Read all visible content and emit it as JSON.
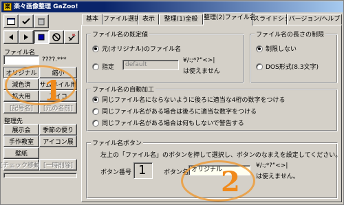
{
  "window": {
    "title": "楽々画像整理 GaZoo!",
    "icon_text": "楽"
  },
  "toolbar": {
    "icons": [
      "window-icon",
      "check-icon",
      "trash-icon",
      "back-icon",
      "forward-icon",
      "stop-icon",
      "no-entry-icon",
      "erase-icon"
    ]
  },
  "sidebar": {
    "filename_label": "ファイル名",
    "filename_value": "",
    "filename_ext": "????.***",
    "name_buttons": [
      "オリジナル",
      "縮小",
      "減色済",
      "サムネイル用",
      "拡大用",
      "アイコ"
    ],
    "disabled_buttons": [
      "[記号名]",
      "[元の名前]"
    ],
    "organize_label": "整理先",
    "folder_buttons": [
      "展示会",
      "季節の便り",
      "手作教室",
      "アイコン展",
      "壁紙"
    ],
    "action_buttons": [
      "[チェック移動]",
      "[一時削除]"
    ]
  },
  "tabs": [
    {
      "label": "基本",
      "active": false
    },
    {
      "label": "ファイル選択",
      "active": false
    },
    {
      "label": "表示",
      "active": false
    },
    {
      "label": "整理(1)全般",
      "active": false
    },
    {
      "label": "整理(2)ファイル名",
      "active": true
    },
    {
      "label": "スライドショー",
      "active": false
    },
    {
      "label": "バージョン/ヘルプ",
      "active": false
    }
  ],
  "default_group": {
    "title": "ファイル名の既定値",
    "option_original": "元(オリジナル)のファイル名",
    "option_custom": "指定",
    "custom_value": "default",
    "invalid_chars": "¥/:;*?\"<>|",
    "invalid_note": "は使えません"
  },
  "length_group": {
    "title": "ファイル名の長さの制限",
    "option_unlimited": "制限しない",
    "option_dos": "DOS形式(8.3文字)"
  },
  "auto_group": {
    "title": "ファイル名の自動加工",
    "options": [
      "同じファイル名にならないように後ろに適当な4桁の数字をつける",
      "同じファイル名がある場合は後ろに適当な数字をつける",
      "同じファイル名がある場合は何もしないで警告する"
    ]
  },
  "button_group": {
    "title": "ファイル名ボタン",
    "instruction": "左上の「ファイル名」のボタンを押して選択し、ボタンのなまえを設定してください。",
    "number_label": "ボタン番号",
    "number_value": "1",
    "name_label": "ボタン名",
    "name_value": "オリジナル",
    "invalid_chars": "¥/:;*?\"<>|",
    "invalid_note": "は使えません。"
  },
  "annotations": {
    "one": "1",
    "two": "2",
    "color": "#f08a1c"
  }
}
